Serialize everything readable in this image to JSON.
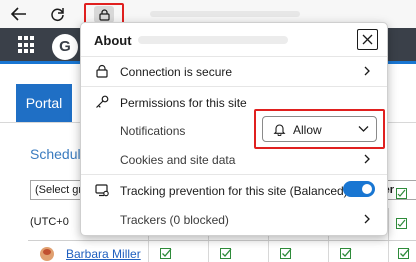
{
  "browser": {
    "back_icon": "arrow-left-icon",
    "refresh_icon": "refresh-icon",
    "site_info_icon": "lock-icon"
  },
  "app": {
    "launcher_icon": "grid-icon",
    "logo_letter": "G",
    "portal_tab": "Portal",
    "schedule_title": "Schedule",
    "group_select_value": "(Select gro",
    "member_button": "ember",
    "timezone_label": "(UTC+0",
    "user_name": "Barbara Miller"
  },
  "popup": {
    "title": "About",
    "close_icon": "close-icon",
    "connection": {
      "label": "Connection is secure",
      "icon": "lock-icon"
    },
    "permissions": {
      "label": "Permissions for this site",
      "icon": "key-icon"
    },
    "notifications": {
      "label": "Notifications",
      "value": "Allow",
      "icon": "bell-icon"
    },
    "cookies": {
      "label": "Cookies and site data"
    },
    "tracking": {
      "label": "Tracking prevention for this site (Balanced)",
      "icon": "tracking-icon",
      "enabled": true
    },
    "trackers": {
      "label": "Trackers (0 blocked)"
    }
  },
  "colors": {
    "accent": "#1976d2",
    "highlight": "#e0201f",
    "app_bar": "#3a4049"
  }
}
